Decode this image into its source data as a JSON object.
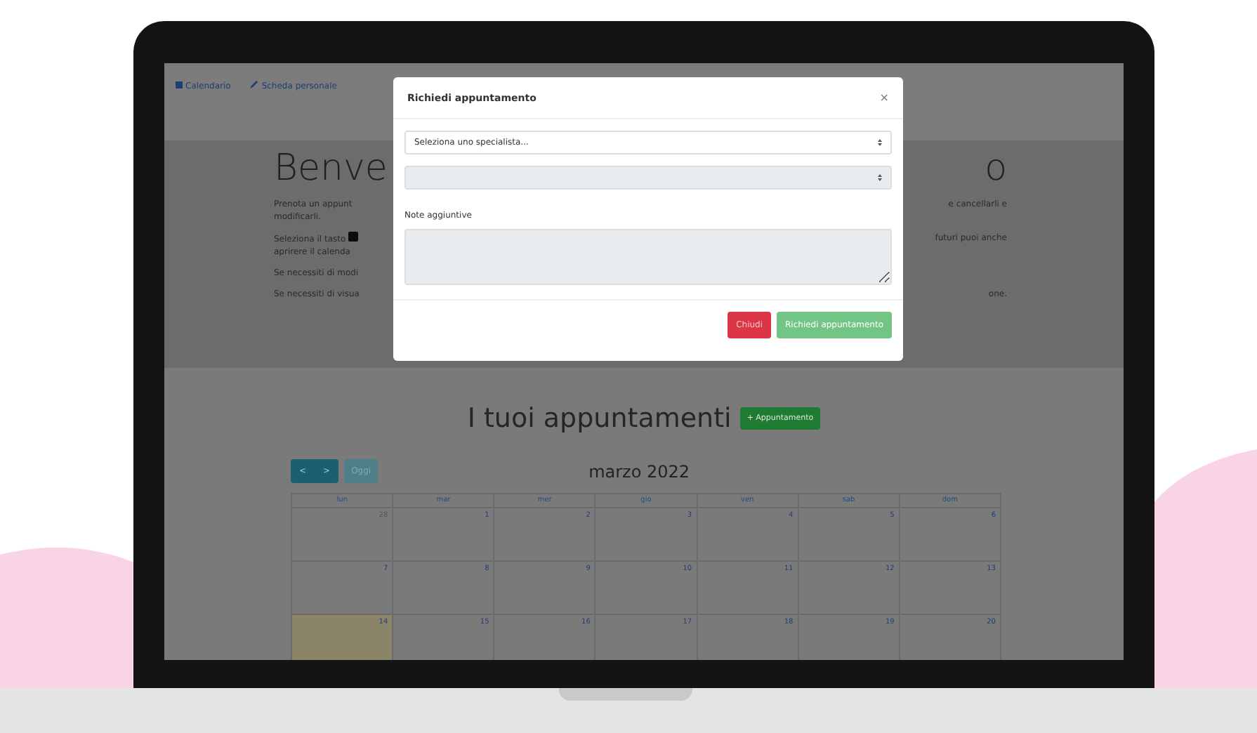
{
  "navbar": {
    "items": [
      {
        "label": "Calendario",
        "kind": "calendar"
      },
      {
        "label": "Scheda personale",
        "kind": "pencil"
      }
    ]
  },
  "welcome": {
    "title_left": "Benve",
    "title_right": "o",
    "paragraphs": [
      {
        "lines": [
          {
            "left": "Prenota un appunt",
            "right": "e cancellarli e"
          },
          {
            "left": "modificarli."
          }
        ]
      },
      {
        "lines": [
          {
            "left": "Seleziona il tasto",
            "badge": true,
            "right": "futuri puoi anche"
          },
          {
            "left": "aprirere il calenda"
          }
        ]
      },
      {
        "lines": [
          {
            "left": "Se necessiti di modi"
          }
        ]
      },
      {
        "lines": [
          {
            "left": "Se necessiti di visua",
            "right": "one."
          }
        ]
      }
    ]
  },
  "modal": {
    "title": "Richiedi appuntamento",
    "close": "×",
    "selects": [
      {
        "value": "Seleziona uno specialista...",
        "disabled": false
      },
      {
        "disabled": true
      }
    ],
    "notes_label": "Note aggiuntive",
    "notes_disabled": true,
    "buttons": [
      {
        "label": "Chiudi",
        "kind": "danger",
        "disabled": false
      },
      {
        "label": "Richiedi appuntamento",
        "kind": "success",
        "disabled": true
      }
    ]
  },
  "appointments": {
    "title": "I tuoi appuntamenti",
    "add_button": "+ Appuntamento",
    "calendar": {
      "nav_buttons": [
        "<",
        ">"
      ],
      "today_button": {
        "label": "Oggi",
        "disabled": true
      },
      "title": "marzo 2022",
      "weekdays": [
        "lun",
        "mar",
        "mer",
        "gio",
        "ven",
        "sab",
        "dom"
      ],
      "weeks": [
        [
          {
            "day": "28",
            "other_month": true,
            "today": false
          },
          {
            "day": "1",
            "other_month": false,
            "today": false
          },
          {
            "day": "2",
            "other_month": false,
            "today": false
          },
          {
            "day": "3",
            "other_month": false,
            "today": false
          },
          {
            "day": "4",
            "other_month": false,
            "today": false
          },
          {
            "day": "5",
            "other_month": false,
            "today": false
          },
          {
            "day": "6",
            "other_month": false,
            "today": false
          }
        ],
        [
          {
            "day": "7",
            "other_month": false,
            "today": false
          },
          {
            "day": "8",
            "other_month": false,
            "today": false
          },
          {
            "day": "9",
            "other_month": false,
            "today": false
          },
          {
            "day": "10",
            "other_month": false,
            "today": false
          },
          {
            "day": "11",
            "other_month": false,
            "today": false
          },
          {
            "day": "12",
            "other_month": false,
            "today": false
          },
          {
            "day": "13",
            "other_month": false,
            "today": false
          }
        ],
        [
          {
            "day": "14",
            "other_month": false,
            "today": true
          },
          {
            "day": "15",
            "other_month": false,
            "today": false
          },
          {
            "day": "16",
            "other_month": false,
            "today": false
          },
          {
            "day": "17",
            "other_month": false,
            "today": false
          },
          {
            "day": "18",
            "other_month": false,
            "today": false
          },
          {
            "day": "19",
            "other_month": false,
            "today": false
          },
          {
            "day": "20",
            "other_month": false,
            "today": false
          }
        ]
      ]
    }
  }
}
